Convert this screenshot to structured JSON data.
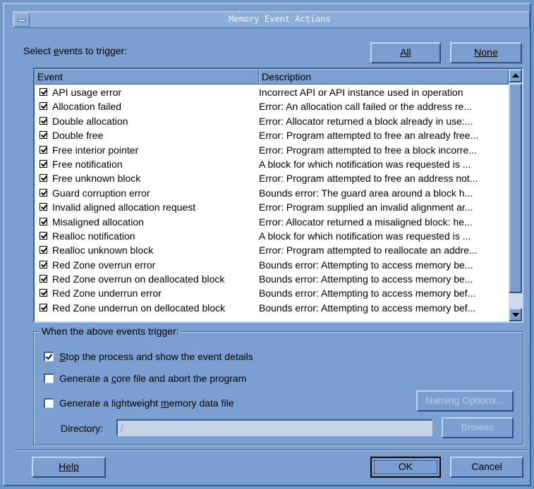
{
  "window": {
    "title": "Memory Event Actions"
  },
  "select_label_parts": [
    "Select ",
    "e",
    "vents to trigger:"
  ],
  "buttons": {
    "all": "All",
    "none": "None",
    "naming_options": "Naming Options...",
    "browse": "Browse",
    "help": "Help",
    "ok": "OK",
    "cancel": "Cancel"
  },
  "table": {
    "headers": {
      "event": "Event",
      "description": "Description"
    },
    "rows": [
      {
        "event": "API usage error",
        "description": "Incorrect API or API instance used in operation",
        "checked": true
      },
      {
        "event": "Allocation failed",
        "description": "Error: An allocation call failed or the address re...",
        "checked": true
      },
      {
        "event": "Double allocation",
        "description": "Error: Allocator returned a block already in use:...",
        "checked": true
      },
      {
        "event": "Double free",
        "description": "Error: Program attempted to free an already free...",
        "checked": true
      },
      {
        "event": "Free interior pointer",
        "description": "Error: Program attempted to free a block incorre...",
        "checked": true
      },
      {
        "event": "Free notification",
        "description": "A block for which notification was requested is ...",
        "checked": true
      },
      {
        "event": "Free unknown block",
        "description": "Error: Program attempted to free an address not...",
        "checked": true
      },
      {
        "event": "Guard corruption error",
        "description": "Bounds error: The guard area around a block h...",
        "checked": true
      },
      {
        "event": "Invalid aligned allocation request",
        "description": "Error: Program supplied an invalid alignment ar...",
        "checked": true
      },
      {
        "event": "Misaligned allocation",
        "description": "Error: Allocator returned a misaligned block: he...",
        "checked": true
      },
      {
        "event": "Realloc notification",
        "description": "A block for which notification was requested is ...",
        "checked": true
      },
      {
        "event": "Realloc unknown block",
        "description": "Error: Program attempted to reallocate an addre...",
        "checked": true
      },
      {
        "event": "Red Zone overrun error",
        "description": "Bounds error: Attempting to access memory be...",
        "checked": true
      },
      {
        "event": "Red Zone overrun on deallocated block",
        "description": "Bounds error: Attempting to access memory be...",
        "checked": true
      },
      {
        "event": "Red Zone underrun error",
        "description": "Bounds error: Attempting to access memory bef...",
        "checked": true
      },
      {
        "event": "Red Zone underrun on dellocated block",
        "description": "Bounds error: Attempting to access memory bef...",
        "checked": true
      }
    ]
  },
  "actions": {
    "group_title": "When the above events trigger:",
    "stop": {
      "parts": [
        "",
        "S",
        "top the process and show the event details"
      ],
      "checked": true
    },
    "core": {
      "parts": [
        "Generate a ",
        "c",
        "ore file and abort the program"
      ],
      "checked": false
    },
    "lightweight": {
      "parts": [
        "Generate a lightweight ",
        "m",
        "emory data file"
      ],
      "checked": false
    },
    "directory_label": "Directory:",
    "directory_value": "/"
  },
  "colors": {
    "background": "#7b9fd0",
    "list_bg": "#ffffff",
    "disabled_text": "#b9cce6"
  }
}
